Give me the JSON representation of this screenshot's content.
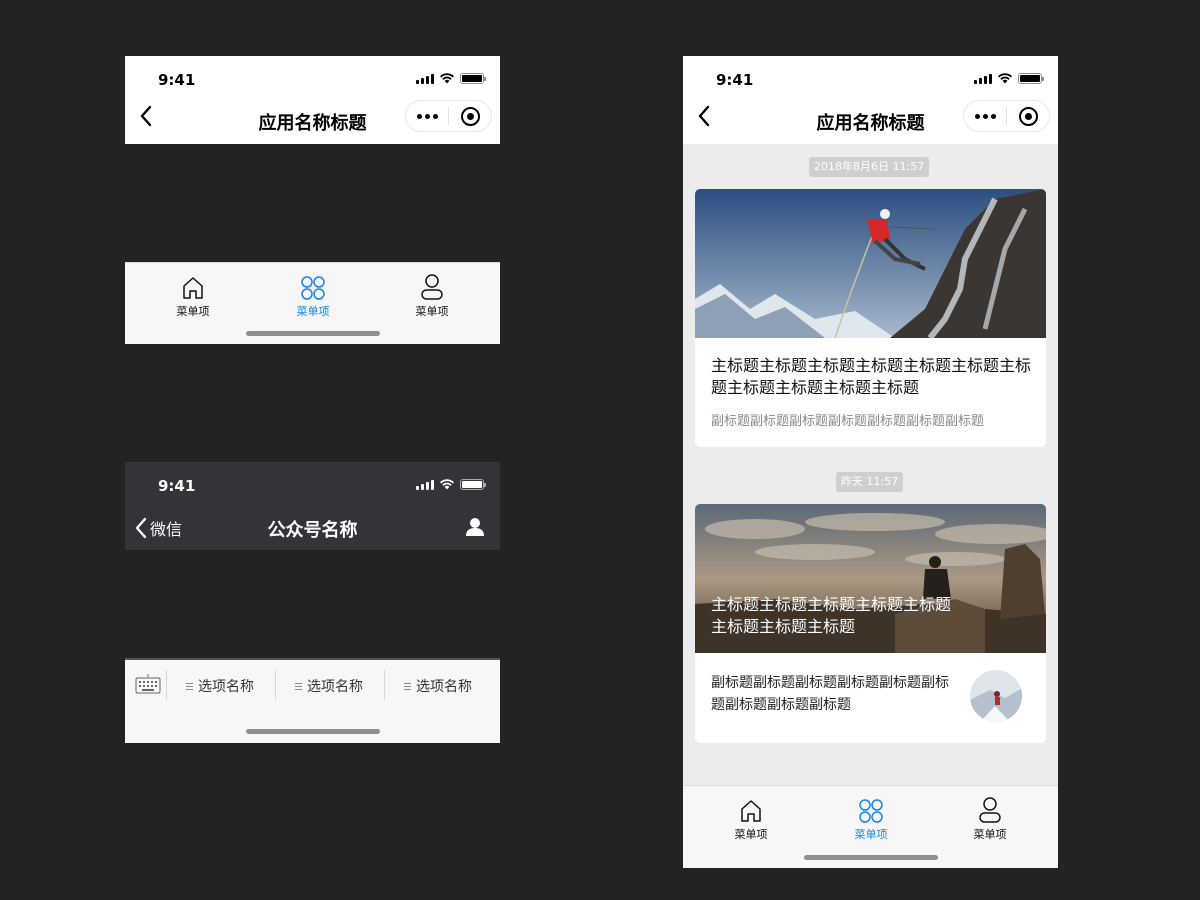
{
  "status_bar": {
    "time": "9:41"
  },
  "miniprogram_nav": {
    "title": "应用名称标题"
  },
  "tabbar": {
    "items": [
      {
        "label": "菜单项",
        "icon": "home-icon",
        "active": false
      },
      {
        "label": "菜单项",
        "icon": "clover-icon",
        "active": true
      },
      {
        "label": "菜单项",
        "icon": "user-icon",
        "active": false
      }
    ],
    "active_color": "#1485ee"
  },
  "official_account_nav": {
    "back_label": "微信",
    "title": "公众号名称"
  },
  "menu_bar": {
    "items": [
      "选项名称",
      "选项名称",
      "选项名称"
    ]
  },
  "feed": {
    "stamp1": "2018年8月6日 11:57",
    "card1": {
      "title": "主标题主标题主标题主标题主标题主标题主标题主标题主标题主标题主标题",
      "subtitle": "副标题副标题副标题副标题副标题副标题副标题"
    },
    "stamp2": "昨天 11:57",
    "card2": {
      "title": "主标题主标题主标题主标题主标题主标题主标题主标题",
      "subtitle": "副标题副标题副标题副标题副标题副标题副标题副标题副标题"
    }
  }
}
